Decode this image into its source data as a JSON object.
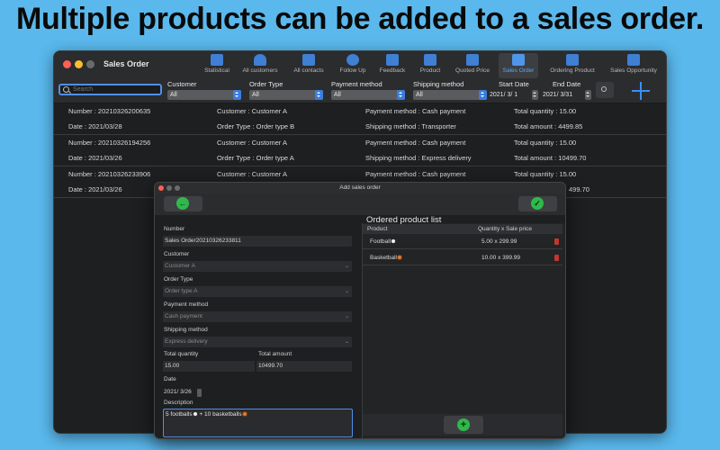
{
  "headline": "Multiple products can be added to a sales order.",
  "window": {
    "title": "Sales Order",
    "traffic_lights": [
      "#fe5f57",
      "#febc2e",
      "#6a6b6d"
    ]
  },
  "toolbar": {
    "items": [
      {
        "label": "Statistical",
        "icon": "chart-icon",
        "color": "#4a8fe0"
      },
      {
        "label": "All customers",
        "icon": "customers-icon",
        "color": "#4a8fe0"
      },
      {
        "label": "All contacts",
        "icon": "contacts-icon",
        "color": "#4a8fe0"
      },
      {
        "label": "Follow Up",
        "icon": "follow-up-icon",
        "color": "#4a8fe0"
      },
      {
        "label": "Feedback",
        "icon": "feedback-icon",
        "color": "#4a8fe0"
      },
      {
        "label": "Product",
        "icon": "product-icon",
        "color": "#4a8fe0"
      },
      {
        "label": "Quoted Price",
        "icon": "quoted-price-icon",
        "color": "#4a8fe0"
      },
      {
        "label": "Sales Order",
        "icon": "sales-order-icon",
        "color": "#4a8fe0",
        "active": true
      },
      {
        "label": "Ordering Product",
        "icon": "cart-icon",
        "color": "#4a8fe0"
      },
      {
        "label": "Sales Opportunity",
        "icon": "opportunity-icon",
        "color": "#4a8fe0"
      }
    ]
  },
  "filters": {
    "search_placeholder": "Search",
    "customer": {
      "label": "Customer",
      "value": "All"
    },
    "order_type": {
      "label": "Order Type",
      "value": "All"
    },
    "payment_method": {
      "label": "Payment method",
      "value": "All"
    },
    "shipping_method": {
      "label": "Shipping method",
      "value": "All"
    },
    "start_date": {
      "label": "Start Date",
      "value": "2021/  3/  1"
    },
    "end_date": {
      "label": "End Date",
      "value": "2021/  3/31"
    }
  },
  "orders": [
    {
      "number": "Number : 20210326200635",
      "customer": "Customer : Customer A",
      "payment": "Payment method : Cash payment",
      "quantity": "Total quantity : 15.00",
      "date": "Date : 2021/03/28",
      "order_type": "Order Type : Order type B",
      "shipping": "Shipping method : Transporter",
      "amount": "Total amount : 4499.85"
    },
    {
      "number": "Number : 20210326194256",
      "customer": "Customer : Customer A",
      "payment": "Payment method : Cash payment",
      "quantity": "Total quantity : 15.00",
      "date": "Date : 2021/03/26",
      "order_type": "Order Type : Order type A",
      "shipping": "Shipping method : Express delivery",
      "amount": "Total amount : 10499.70"
    },
    {
      "number": "Number : 20210326233906",
      "customer": "Customer : Customer A",
      "payment": "Payment method : Cash payment",
      "quantity": "Total quantity : 15.00",
      "date": "Date : 2021/03/26",
      "order_type": "",
      "shipping": "",
      "amount": "499.70"
    }
  ],
  "dialog": {
    "title": "Add sales order",
    "back_icon": "back-arrow-icon",
    "confirm_icon": "checkmark-icon",
    "fields": {
      "number_label": "Number",
      "number_value": "Sales Order20210326233811",
      "customer_label": "Customer",
      "customer_value": "Customer A",
      "order_type_label": "Order Type",
      "order_type_value": "Order type A",
      "payment_label": "Payment method",
      "payment_value": "Cash payment",
      "shipping_label": "Shipping method",
      "shipping_value": "Express delivery",
      "total_quantity_label": "Total quantity",
      "total_quantity_value": "15.00",
      "total_amount_label": "Total amount",
      "total_amount_value": "10499.70",
      "date_label": "Date",
      "date_value": "2021/  3/26",
      "description_label": "Description",
      "description_part1": "5 footballs",
      "description_part2": " + 10 basketballs"
    },
    "product_list": {
      "title": "Ordered product list",
      "col_product": "Product",
      "col_qty_price": "Quantity x Sale price",
      "rows": [
        {
          "product": "Football",
          "ball": "soccer",
          "qty_price": "5.00 x 299.99"
        },
        {
          "product": "Basketball",
          "ball": "basket",
          "qty_price": "10.00 x 399.99"
        }
      ]
    }
  }
}
